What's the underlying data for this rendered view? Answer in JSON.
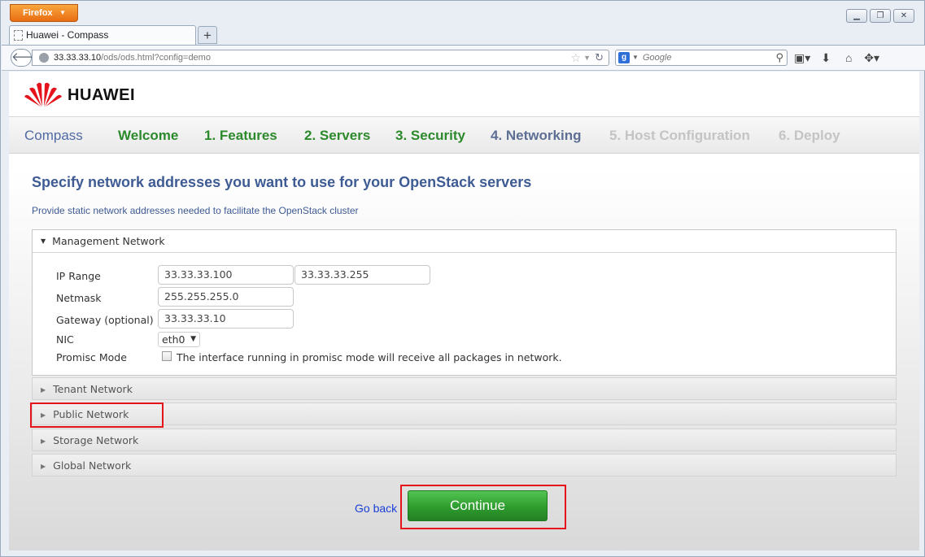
{
  "browser": {
    "menu_label": "Firefox",
    "window_controls": [
      "minimize-icon",
      "restore-icon",
      "close-icon"
    ],
    "tab_title": "Huawei - Compass",
    "new_tab_label": "+",
    "url_host": "33.33.33.10",
    "url_path": "/ods/ods.html?config=demo",
    "search_placeholder": "Google",
    "toolbar_icons": [
      "bookmarks-icon",
      "download-icon",
      "home-icon",
      "addon-icon"
    ]
  },
  "header": {
    "brand": "HUAWEI",
    "brand_color": "#e4131c"
  },
  "steps": {
    "app_name": "Compass",
    "items": [
      {
        "label": "Welcome",
        "state": "done"
      },
      {
        "label": "1. Features",
        "state": "done"
      },
      {
        "label": "2. Servers",
        "state": "done"
      },
      {
        "label": "3. Security",
        "state": "done"
      },
      {
        "label": "4. Networking",
        "state": "current"
      },
      {
        "label": "5. Host Configuration",
        "state": "future"
      },
      {
        "label": "6. Deploy",
        "state": "future"
      }
    ]
  },
  "page": {
    "title": "Specify network addresses you want to use for your OpenStack servers",
    "subtitle": "Provide static network addresses needed to facilitate the OpenStack cluster"
  },
  "management": {
    "header": "Management Network",
    "ip_range_label": "IP Range",
    "ip_start": "33.33.33.100",
    "ip_end": "33.33.33.255",
    "netmask_label": "Netmask",
    "netmask": "255.255.255.0",
    "gateway_label": "Gateway (optional)",
    "gateway": "33.33.33.10",
    "nic_label": "NIC",
    "nic_value": "eth0",
    "promisc_label": "Promisc Mode",
    "promisc_checked": false,
    "promisc_text": "The interface running in promisc mode will receive all packages in network."
  },
  "sections": [
    "Tenant Network",
    "Public Network",
    "Storage Network",
    "Global Network"
  ],
  "actions": {
    "go_back": "Go back",
    "continue": "Continue"
  },
  "colors": {
    "step_done": "#2c8a2c",
    "step_current": "#5d6f93",
    "step_future": "#c4c4c4",
    "title": "#3e5b94",
    "continue_button": "#2e9c2e",
    "highlight_box": "#e4131c"
  }
}
